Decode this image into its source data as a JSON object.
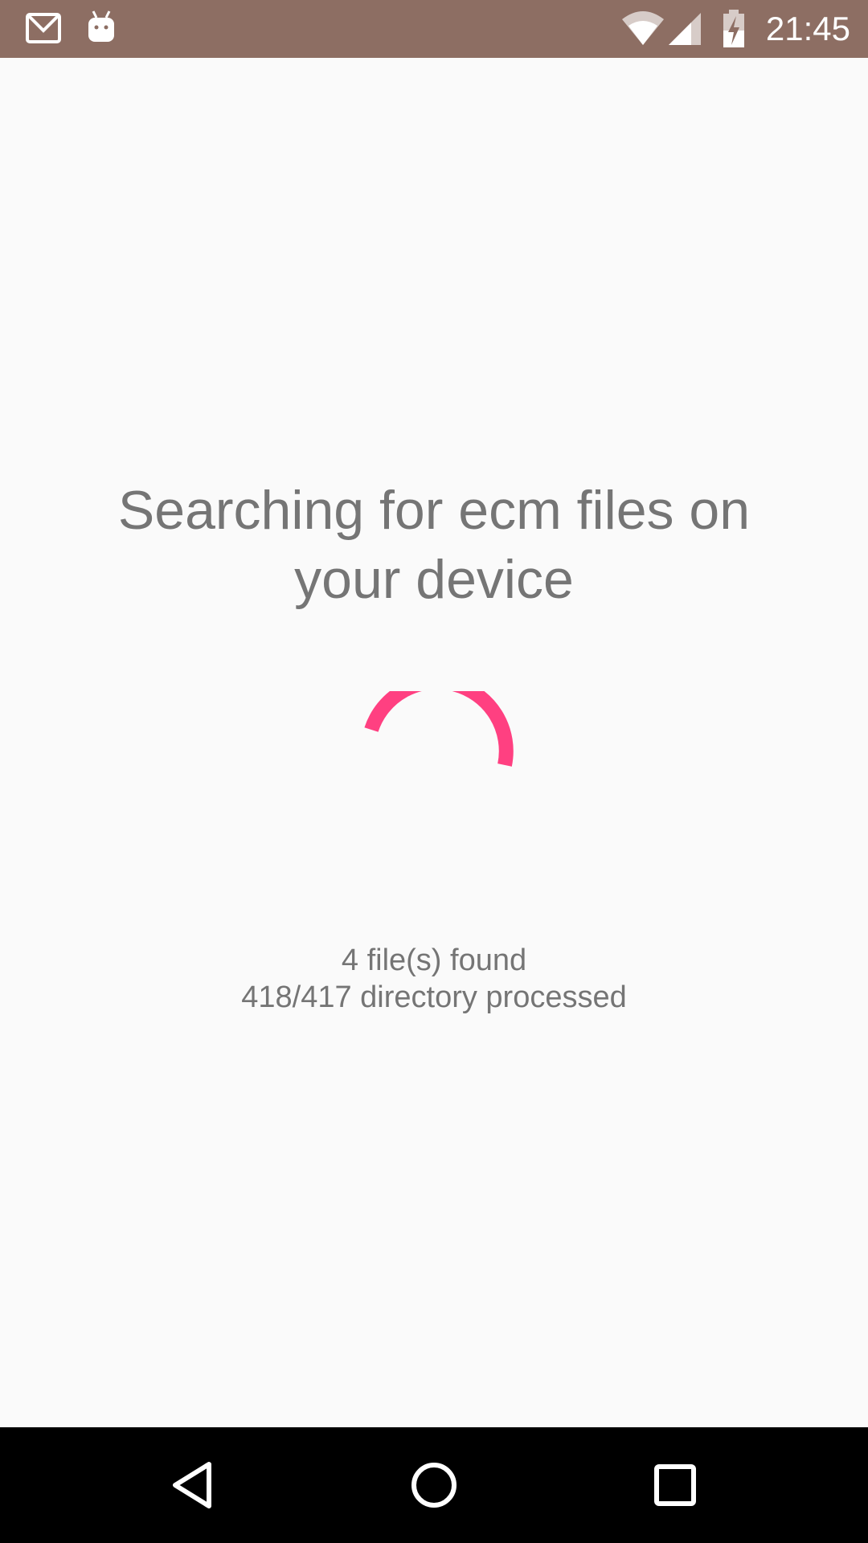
{
  "status_bar": {
    "time": "21:45",
    "icons": [
      "gmail-icon",
      "android-icon",
      "wifi-icon",
      "signal-icon",
      "battery-charging-icon"
    ],
    "background_color": "#8d6e63"
  },
  "main": {
    "title": "Searching for ecm files on your device",
    "files_found": "4 file(s) found",
    "directories_processed": "418/417 directory processed",
    "spinner_color": "#ff4081",
    "text_color": "#757575"
  },
  "nav_bar": {
    "buttons": [
      "back",
      "home",
      "recents"
    ]
  }
}
